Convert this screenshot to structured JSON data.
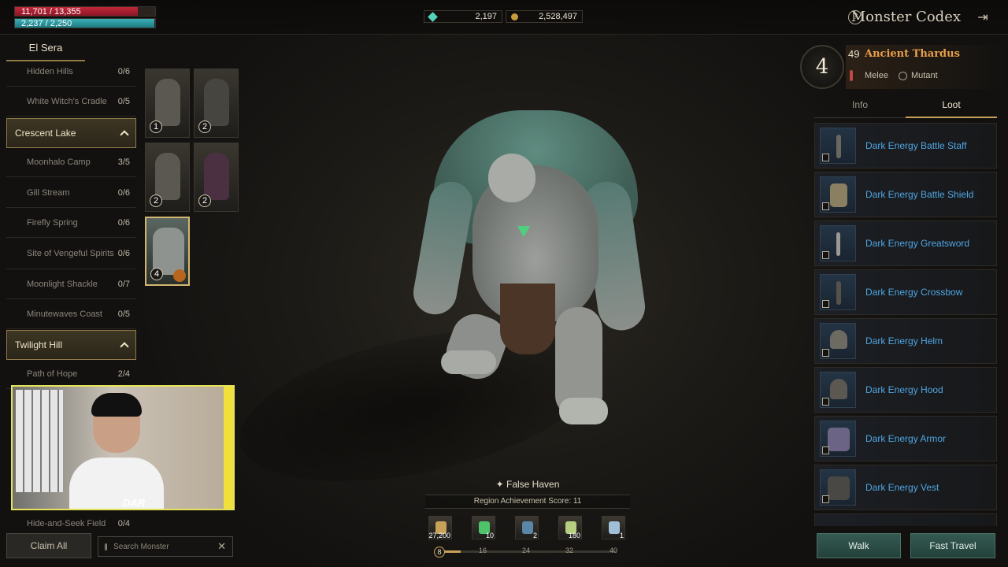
{
  "player": {
    "hp_text": "11,701 / 13,355",
    "hp_fraction": 0.876,
    "mp_text": "2,237 / 2,250",
    "mp_fraction": 0.994
  },
  "currencies": {
    "gems": "2,197",
    "gold": "2,528,497"
  },
  "header": {
    "title": "Monster Codex",
    "help_glyph": "?",
    "exit_glyph": "⇥"
  },
  "region": {
    "title": "El Sera",
    "locations": [
      {
        "name": "Hidden Hills",
        "count": "0/6"
      },
      {
        "name": "White Witch's Cradle",
        "count": "0/5"
      }
    ],
    "group_crescent": "Crescent Lake",
    "crescent_locations": [
      {
        "name": "Moonhalo Camp",
        "count": "3/5"
      },
      {
        "name": "Gill Stream",
        "count": "0/6"
      },
      {
        "name": "Firefly Spring",
        "count": "0/6"
      },
      {
        "name": "Site of Vengeful Spirits",
        "count": "0/6"
      },
      {
        "name": "Moonlight Shackle",
        "count": "0/7"
      },
      {
        "name": "Minutewaves Coast",
        "count": "0/5"
      }
    ],
    "group_twilight": "Twilight Hill",
    "twilight_locations": [
      {
        "name": "Path of Hope",
        "count": "2/4"
      }
    ],
    "last_location": {
      "name": "Hide-and-Seek Field",
      "count": "0/4"
    }
  },
  "monster_cards": [
    {
      "tier": "1"
    },
    {
      "tier": "2"
    },
    {
      "tier": "2"
    },
    {
      "tier": "2"
    },
    {
      "tier": "4"
    }
  ],
  "webcam": {
    "shirt_text": "DAR"
  },
  "controls": {
    "claim_all": "Claim All",
    "search_placeholder": "Search Monster",
    "clear_glyph": "✕"
  },
  "area": {
    "name": "✦ False Haven",
    "score": "Region Achievement Score: 11"
  },
  "rewards": [
    {
      "icon": "achievement-icon",
      "qty": "27,200",
      "color": "#c9a25a"
    },
    {
      "icon": "potion-icon",
      "qty": "10",
      "color": "#4fc36a"
    },
    {
      "icon": "ore-icon",
      "qty": "2",
      "color": "#5a86a8"
    },
    {
      "icon": "crystal-icon",
      "qty": "180",
      "color": "#b7d080"
    },
    {
      "icon": "feather-icon",
      "qty": "1",
      "color": "#9fc0d8"
    }
  ],
  "progress": {
    "fraction": 0.13,
    "ticks": [
      "8",
      "16",
      "24",
      "32",
      "40"
    ]
  },
  "monster": {
    "level_badge": "4",
    "level": "49",
    "name": "Ancient Thardus",
    "attack": "Melee",
    "type": "Mutant"
  },
  "tabs": {
    "info": "Info",
    "loot": "Loot"
  },
  "loot": [
    {
      "name": "Dark Energy Battle Staff"
    },
    {
      "name": "Dark Energy Battle Shield"
    },
    {
      "name": "Dark Energy Greatsword"
    },
    {
      "name": "Dark Energy Crossbow"
    },
    {
      "name": "Dark Energy Helm"
    },
    {
      "name": "Dark Energy Hood"
    },
    {
      "name": "Dark Energy Armor"
    },
    {
      "name": "Dark Energy Vest"
    }
  ],
  "actions": {
    "walk": "Walk",
    "fast_travel": "Fast Travel"
  },
  "colors": {
    "accent_gold": "#c9a25a",
    "loot_blue": "#4fa6e3",
    "monster_name": "#e8a04a",
    "hp_red": "#c2283a",
    "mp_teal": "#3ab0b5"
  }
}
